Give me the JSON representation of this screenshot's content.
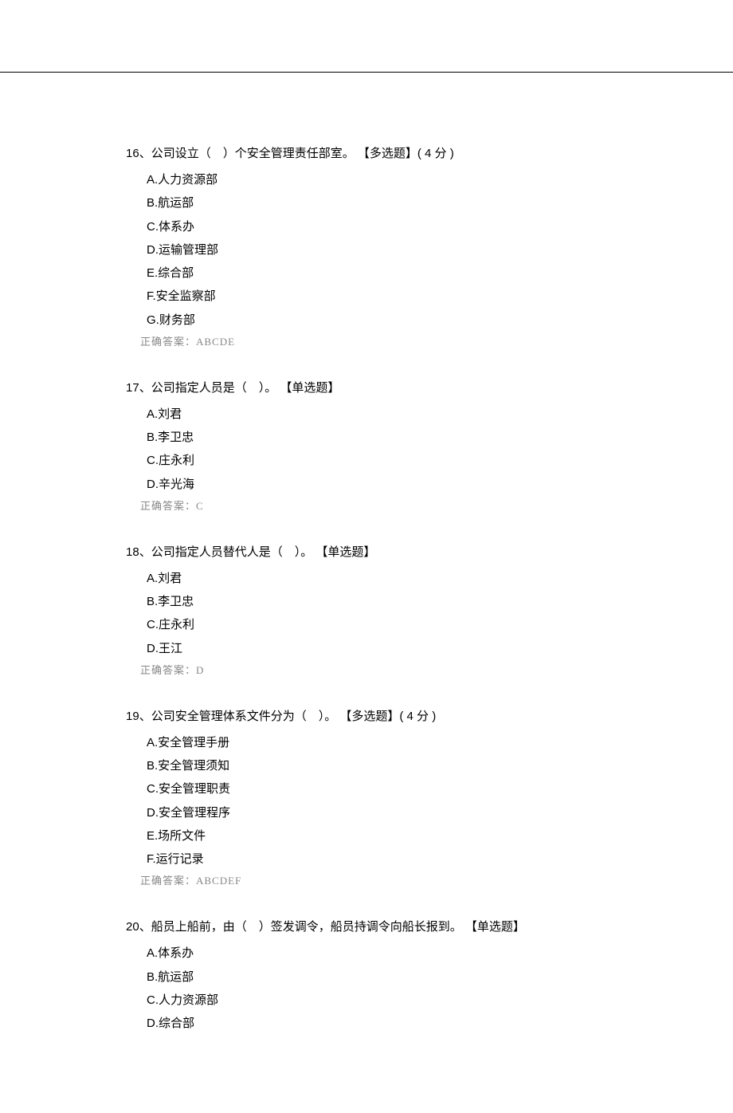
{
  "questions": [
    {
      "number": "16",
      "text": "、公司设立（　）个安全管理责任部室。  【多选题】( 4 分 )",
      "options": [
        "A.人力资源部",
        "B.航运部",
        "C.体系办",
        "D.运输管理部",
        "E.综合部",
        "F.安全监察部",
        "G.财务部"
      ],
      "answer": "正确答案：ABCDE"
    },
    {
      "number": "17",
      "text": "、公司指定人员是（　）。  【单选题】",
      "options": [
        "A.刘君",
        "B.李卫忠",
        "C.庄永利",
        "D.辛光海"
      ],
      "answer": "正确答案：C"
    },
    {
      "number": "18",
      "text": "、公司指定人员替代人是（　）。  【单选题】",
      "options": [
        "A.刘君",
        "B.李卫忠",
        "C.庄永利",
        "D.王江"
      ],
      "answer": "正确答案：D"
    },
    {
      "number": "19",
      "text": "、公司安全管理体系文件分为（　）。  【多选题】( 4 分 )",
      "options": [
        "A.安全管理手册",
        "B.安全管理须知",
        "C.安全管理职责",
        "D.安全管理程序",
        "E.场所文件",
        "F.运行记录"
      ],
      "answer": "正确答案：ABCDEF"
    },
    {
      "number": "20",
      "text": "、船员上船前，由（　）签发调令，船员持调令向船长报到。  【单选题】",
      "options": [
        "A.体系办",
        "B.航运部",
        "C.人力资源部",
        "D.综合部"
      ],
      "answer": ""
    }
  ]
}
